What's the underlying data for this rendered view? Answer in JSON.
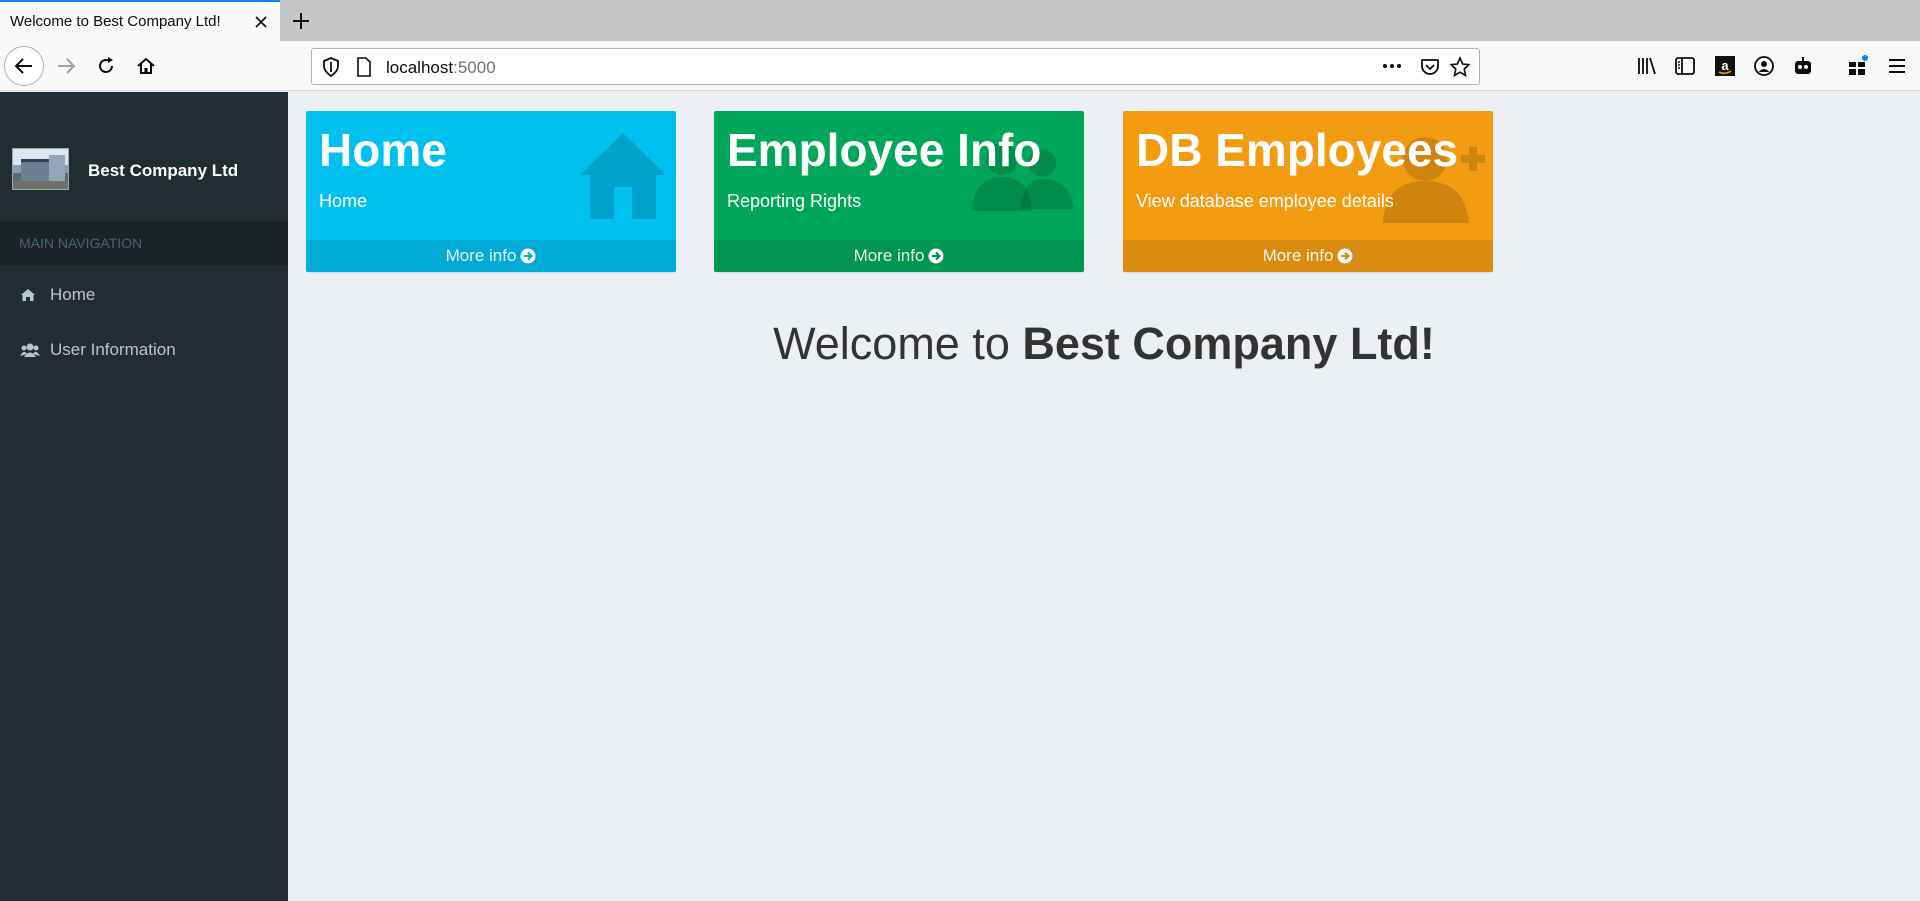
{
  "browser": {
    "tab_title": "Welcome to Best Company Ltd!",
    "url_host": "localhost",
    "url_port": ":5000"
  },
  "sidebar": {
    "brand_name": "Best Company Ltd",
    "nav_header": "MAIN NAVIGATION",
    "items": [
      {
        "label": "Home",
        "icon": "home-icon"
      },
      {
        "label": "User Information",
        "icon": "users-icon"
      }
    ]
  },
  "boxes": [
    {
      "title": "Home",
      "subtitle": "Home",
      "footer": "More info",
      "color": "#00c0ef",
      "icon": "house-icon"
    },
    {
      "title": "Employee Info",
      "subtitle": "Reporting Rights",
      "footer": "More info",
      "color": "#00a65a",
      "icon": "users-icon"
    },
    {
      "title": "DB Employees",
      "subtitle": "View database employee details",
      "footer": "More info",
      "color": "#f39c12",
      "icon": "user-plus-icon"
    }
  ],
  "welcome": {
    "prefix": "Welcome to ",
    "company": "Best Company Ltd!"
  }
}
